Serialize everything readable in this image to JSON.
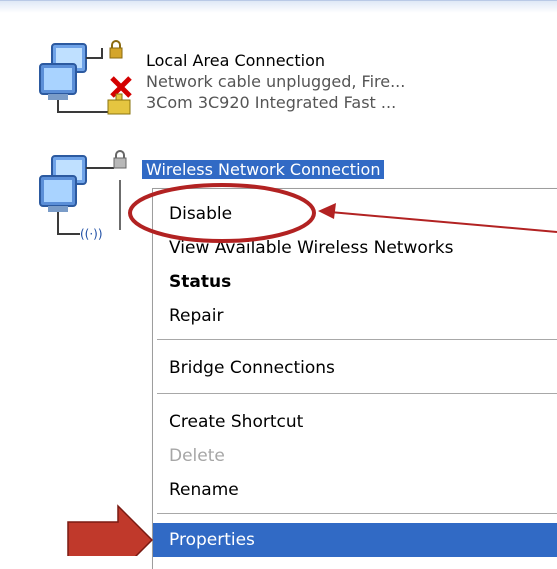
{
  "connections": [
    {
      "name": "Local Area Connection",
      "status": "Network cable unplugged, Fire...",
      "device": "3Com 3C920 Integrated Fast ..."
    },
    {
      "name": "Wireless Network Connection",
      "status": "",
      "device": ""
    }
  ],
  "context_menu": {
    "items": [
      {
        "label": "Disable",
        "style": "normal"
      },
      {
        "label": "View Available Wireless Networks",
        "style": "normal"
      },
      {
        "label": "Status",
        "style": "bold"
      },
      {
        "label": "Repair",
        "style": "normal"
      },
      {
        "label": "Bridge Connections",
        "style": "normal"
      },
      {
        "label": "Create Shortcut",
        "style": "normal"
      },
      {
        "label": "Delete",
        "style": "disabled"
      },
      {
        "label": "Rename",
        "style": "normal"
      },
      {
        "label": "Properties",
        "style": "highlighted"
      }
    ]
  },
  "colors": {
    "selection": "#316ac5",
    "annotation_red": "#b22222",
    "arrow_fill": "#c0392b"
  },
  "icons": [
    "network-computers-icon",
    "lock-icon",
    "error-x-icon",
    "ethernet-plug-icon",
    "wireless-antenna-icon"
  ]
}
